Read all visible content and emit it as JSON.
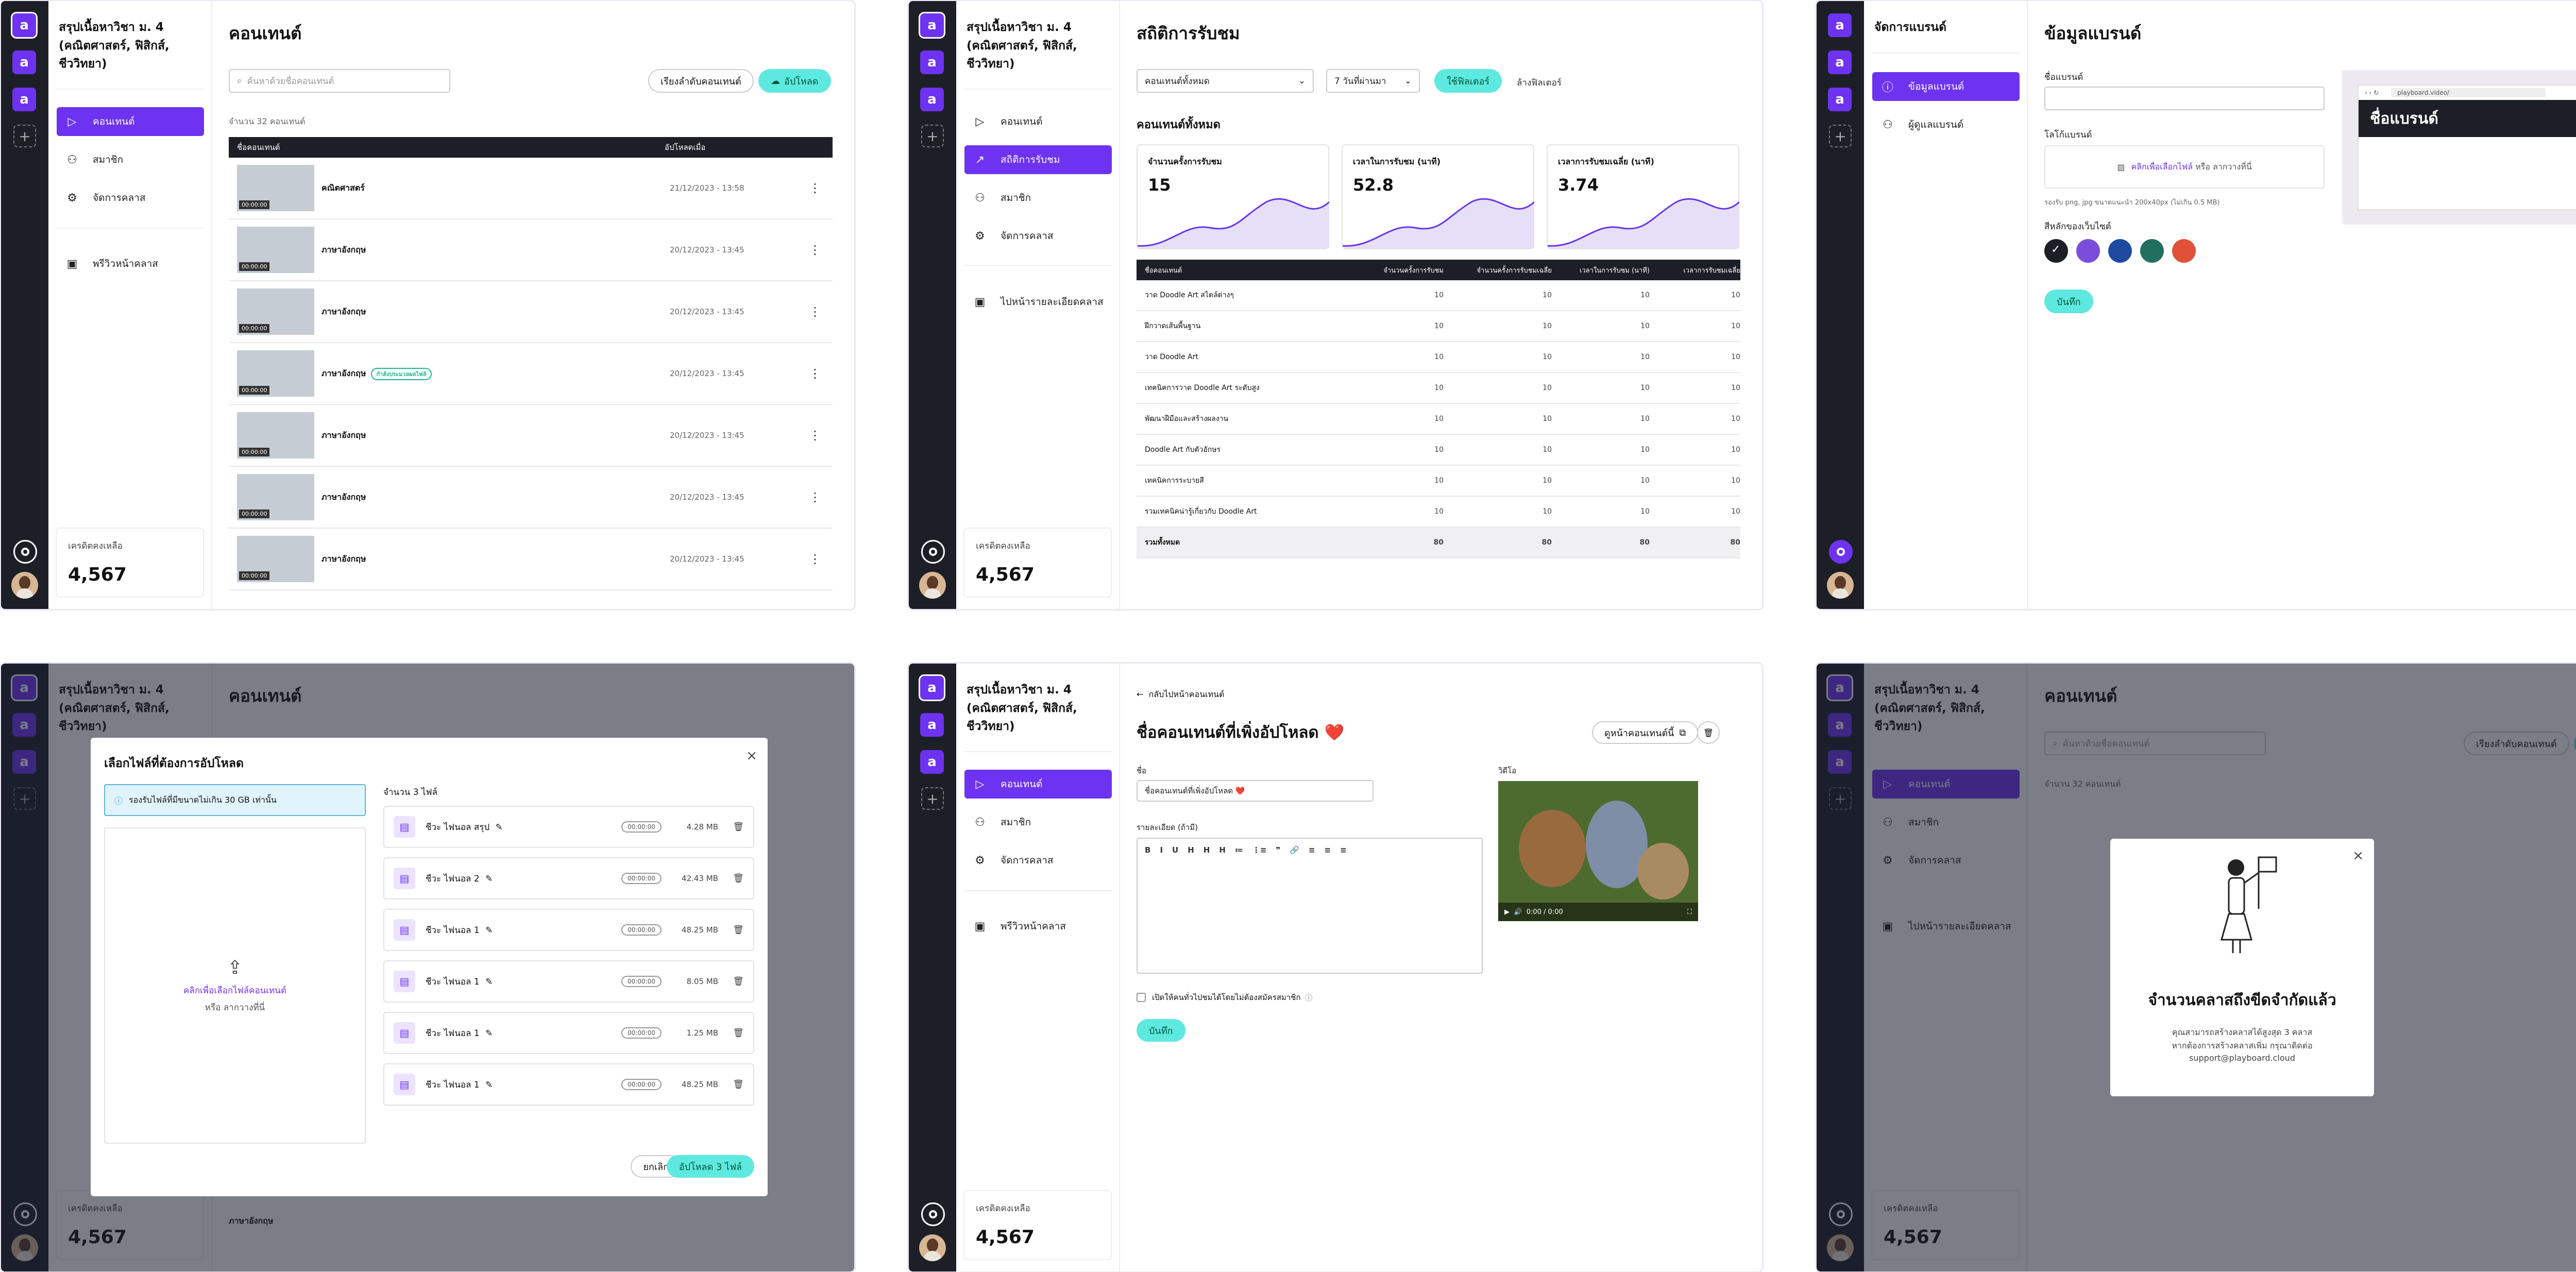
{
  "workspace": {
    "name": "สรุปเนื้อหาวิชา ม. 4 (คณิตศาสตร์, ฟิสิกส์, ชีววิทยา)",
    "icon_letter": "a",
    "brand_menu_title": "จัดการแบรนด์",
    "credit_label": "เครดิตคงเหลือ",
    "credit_value": "4,567"
  },
  "nav": {
    "content": "คอนเทนต์",
    "stats": "สถิติการรับชม",
    "members": "สมาชิก",
    "manage_class": "จัดการคลาส",
    "preview": "พรีวิวหน้าคลาส",
    "to_class_detail": "ไปหน้ารายละเอียดคลาส",
    "brand_info": "ข้อมูลแบรนด์",
    "brand_admin": "ผู้ดูแลแบรนด์"
  },
  "content_page": {
    "title": "คอนเทนต์",
    "search_placeholder": "ค้นหาด้วยชื่อคอนเทนต์",
    "sort_button": "เรียงลำดับคอนเทนต์",
    "upload_button": "อัปโหลด",
    "count": "จำนวน 32 คอนเทนต์",
    "col_name": "ชื่อคอนเทนต์",
    "col_uploaded": "อัปโหลดเมื่อ",
    "thumb_duration": "00:00:00",
    "status_tag": "กำลังประมวลผลไฟล์",
    "rows": [
      {
        "name": "คณิตศาสตร์",
        "date": "21/12/2023 - 13:58",
        "tag": false
      },
      {
        "name": "ภาษาอังกฤษ",
        "date": "20/12/2023 - 13:45",
        "tag": false
      },
      {
        "name": "ภาษาอังกฤษ",
        "date": "20/12/2023 - 13:45",
        "tag": false
      },
      {
        "name": "ภาษาอังกฤษ",
        "date": "20/12/2023 - 13:45",
        "tag": true
      },
      {
        "name": "ภาษาอังกฤษ",
        "date": "20/12/2023 - 13:45",
        "tag": false
      },
      {
        "name": "ภาษาอังกฤษ",
        "date": "20/12/2023 - 13:45",
        "tag": false
      },
      {
        "name": "ภาษาอังกฤษ",
        "date": "20/12/2023 - 13:45",
        "tag": false
      }
    ]
  },
  "stats_page": {
    "title": "สถิติการรับชม",
    "filter_content": "คอนเทนต์ทั้งหมด",
    "filter_days": "7 วันที่ผ่านมา",
    "apply_filter": "ใช้ฟิลเตอร์",
    "clear_filter": "ล้างฟิลเตอร์",
    "section_title": "คอนเทนต์ทั้งหมด",
    "cards": [
      {
        "label": "จำนวนครั้งการรับชม",
        "value": "15"
      },
      {
        "label": "เวลาในการรับชม (นาที)",
        "value": "52.8"
      },
      {
        "label": "เวลาการรับชมเฉลี่ย (นาที)",
        "value": "3.74"
      }
    ],
    "columns": [
      "ชื่อคอนเทนต์",
      "จำนวนครั้งการรับชม",
      "จำนวนครั้งการรับชมเฉลี่ย",
      "เวลาในการรับชม (นาที)",
      "เวลาการรับชมเฉลี่ย"
    ],
    "rows": [
      {
        "name": "วาด Doodle Art สไตล์ต่างๆ",
        "v": [
          "10",
          "10",
          "10",
          "10"
        ]
      },
      {
        "name": "ฝึกวาดเส้นพื้นฐาน",
        "v": [
          "10",
          "10",
          "10",
          "10"
        ]
      },
      {
        "name": "วาด Doodle Art",
        "v": [
          "10",
          "10",
          "10",
          "10"
        ]
      },
      {
        "name": "เทคนิคการวาด Doodle Art ระดับสูง",
        "v": [
          "10",
          "10",
          "10",
          "10"
        ]
      },
      {
        "name": "พัฒนาฝีมือและสร้างผลงาน",
        "v": [
          "10",
          "10",
          "10",
          "10"
        ]
      },
      {
        "name": "Doodle Art กับตัวอักษร",
        "v": [
          "10",
          "10",
          "10",
          "10"
        ]
      },
      {
        "name": "เทคนิคการระบายสี",
        "v": [
          "10",
          "10",
          "10",
          "10"
        ]
      },
      {
        "name": "รวมเทคนิคน่ารู้เกี่ยวกับ Doodle Art",
        "v": [
          "10",
          "10",
          "10",
          "10"
        ]
      }
    ],
    "total_label": "รวมทั้งหมด",
    "totals": [
      "80",
      "80",
      "80",
      "80"
    ]
  },
  "brand_page": {
    "title": "ข้อมูลแบรนด์",
    "name_label": "ชื่อแบรนด์",
    "logo_label": "โลโก้แบรนด์",
    "logo_upload_link": "คลิกเพื่อเลือกไฟล์",
    "logo_upload_rest": "หรือ ลากวางที่นี่",
    "logo_hint": "รองรับ png, jpg ขนาดแนะนำ 200x40px (ไม่เกิน 0.5 MB)",
    "color_label": "สีหลักของเว็บไซต์",
    "colors": [
      "#1c1f26",
      "#7c4ddb",
      "#1e4ba0",
      "#236f5f",
      "#e0513a"
    ],
    "save": "บันทึก",
    "preview_url": "playboard.video/",
    "preview_brand": "ชื่อแบรนด์"
  },
  "upload_modal": {
    "title": "เลือกไฟล์ที่ต้องการอัปโหลด",
    "notice": "รองรับไฟล์ที่มีขนาดไม่เกิน 30 GB เท่านั้น",
    "drop_link": "คลิกเพื่อเลือกไฟล์คอนเทนต์",
    "drop_rest": "หรือ ลากวางที่นี่",
    "count": "จำนวน 3 ไฟล์",
    "files": [
      {
        "name": "ชีวะ ไฟนอล สรุป",
        "duration": "00:00:00",
        "size": "4.28 MB"
      },
      {
        "name": "ชีวะ ไฟนอล 2",
        "duration": "00:00:00",
        "size": "42.43 MB"
      },
      {
        "name": "ชีวะ ไฟนอล 1",
        "duration": "00:00:00",
        "size": "48.25 MB"
      },
      {
        "name": "ชีวะ ไฟนอล 1",
        "duration": "00:00:00",
        "size": "8.05 MB"
      },
      {
        "name": "ชีวะ ไฟนอล 1",
        "duration": "00:00:00",
        "size": "1.25 MB"
      },
      {
        "name": "ชีวะ ไฟนอล 1",
        "duration": "00:00:00",
        "size": "48.25 MB"
      }
    ],
    "cancel": "ยกเลิก",
    "submit": "อัปโหลด 3 ไฟล์"
  },
  "edit_page": {
    "back": "กลับไปหน้าคอนเทนต์",
    "title": "ชื่อคอนเทนต์ที่เพิ่งอัปโหลด ❤️",
    "view_button": "ดูหน้าคอนเทนต์นี้",
    "name_label": "ชื่อ",
    "name_value": "ชื่อคอนเทนต์ที่เพิ่งอัปโหลด ❤️",
    "desc_label": "รายละเอียด (ถ้ามี)",
    "video_label": "วิดีโอ",
    "video_time": "0:00 / 0:00",
    "free_checkbox": "เปิดให้คนทั่วไปชมได้โดยไม่ต้องสมัครสมาชิก",
    "save": "บันทึก",
    "toolbar": [
      "B",
      "I",
      "U",
      "H",
      "H",
      "H",
      "≔",
      "⋮≡",
      "❞",
      "🔗",
      "≡",
      "≡",
      "≡"
    ]
  },
  "limit_modal": {
    "title": "จำนวนคลาสถึงขีดจำกัดแล้ว",
    "body1": "คุณสามารถสร้างคลาสได้สูงสุด 3 คลาส",
    "body2": "หากต้องการสร้างคลาสเพิ่ม กรุณาติดต่อ",
    "email": "support@playboard.cloud"
  }
}
